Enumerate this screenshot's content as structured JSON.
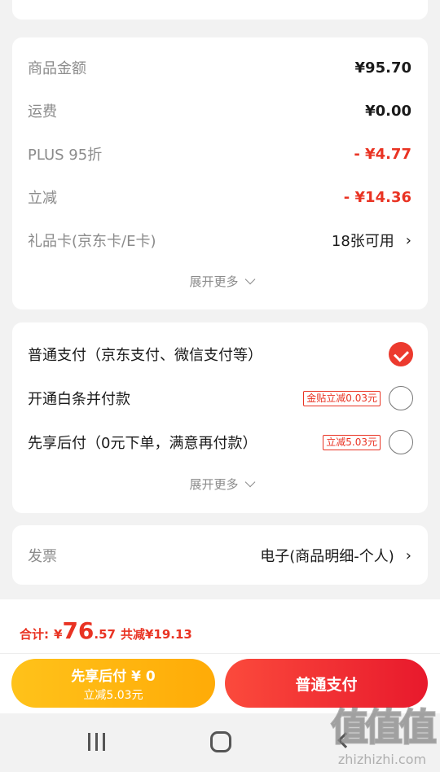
{
  "summary": {
    "rows": [
      {
        "label": "商品金额",
        "value": "¥95.70"
      },
      {
        "label": "运费",
        "value": "¥0.00"
      },
      {
        "label": "PLUS 95折",
        "value": "- ¥4.77"
      },
      {
        "label": "立减",
        "value": "- ¥14.36"
      },
      {
        "label": "礼品卡(京东卡/E卡)",
        "value": "18张可用"
      }
    ],
    "expand_label": "展开更多"
  },
  "payment": {
    "options": [
      {
        "label": "普通支付（京东支付、微信支付等）",
        "badge": "",
        "selected": true
      },
      {
        "label": "开通白条并付款",
        "badge": "金贴立减0.03元",
        "selected": false
      },
      {
        "label": "先享后付（0元下单，满意再付款）",
        "badge": "立减5.03元",
        "selected": false
      }
    ],
    "expand_label": "展开更多"
  },
  "invoice": {
    "label": "发票",
    "value": "电子(商品明细-个人)"
  },
  "total": {
    "label": "合计:",
    "currency": "¥",
    "integer": "76",
    "decimal": ".57",
    "saving": "共减¥19.13"
  },
  "buttons": {
    "pay_later_main": "先享后付 ¥ 0",
    "pay_later_sub": "立减5.03元",
    "normal_pay": "普通支付"
  },
  "watermark": {
    "logo": "值值值",
    "url": "zhizhizhi.com"
  },
  "colors": {
    "accent_red": "#e93323",
    "pay_later_yellow": "#ffb50f",
    "background": "#f2f2f2"
  },
  "icons": {
    "chevron": "chevron-right-icon",
    "checked": "check-circle-icon",
    "unchecked": "radio-circle-icon"
  }
}
